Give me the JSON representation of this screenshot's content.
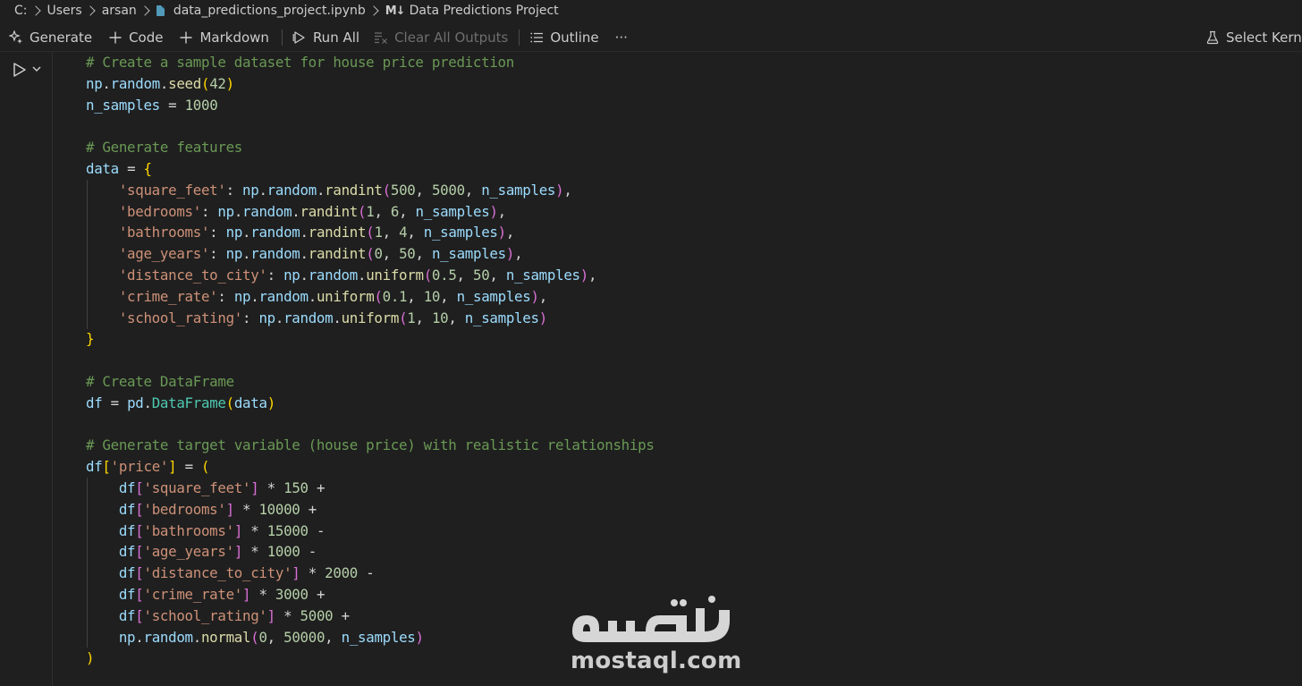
{
  "breadcrumb": {
    "drive": "C:",
    "folder1": "Users",
    "folder2": "arsan",
    "file": "data_predictions_project.ipynb",
    "section": "Data Predictions Project"
  },
  "toolbar": {
    "generate": "Generate",
    "code": "Code",
    "markdown": "Markdown",
    "run_all": "Run All",
    "clear_all_outputs": "Clear All Outputs",
    "outline": "Outline",
    "more": "···",
    "select_kernel": "Select Kernel"
  },
  "cell": {
    "code_lines": [
      "# Create a sample dataset for house price prediction",
      "np.random.seed(42)",
      "n_samples = 1000",
      "",
      "# Generate features",
      "data = {",
      "    'square_feet': np.random.randint(500, 5000, n_samples),",
      "    'bedrooms': np.random.randint(1, 6, n_samples),",
      "    'bathrooms': np.random.randint(1, 4, n_samples),",
      "    'age_years': np.random.randint(0, 50, n_samples),",
      "    'distance_to_city': np.random.uniform(0.5, 50, n_samples),",
      "    'crime_rate': np.random.uniform(0.1, 10, n_samples),",
      "    'school_rating': np.random.uniform(1, 10, n_samples)",
      "}",
      "",
      "# Create DataFrame",
      "df = pd.DataFrame(data)",
      "",
      "# Generate target variable (house price) with realistic relationships",
      "df['price'] = (",
      "    df['square_feet'] * 150 +",
      "    df['bedrooms'] * 10000 +",
      "    df['bathrooms'] * 15000 -",
      "    df['age_years'] * 1000 -",
      "    df['distance_to_city'] * 2000 -",
      "    df['crime_rate'] * 3000 +",
      "    df['school_rating'] * 5000 +",
      "    np.random.normal(0, 50000, n_samples)",
      ")"
    ]
  },
  "watermark": {
    "arabic": "مستقل",
    "latin": "mostaql.com"
  },
  "colors": {
    "background": "#1f1f1f",
    "comment": "#6a9955",
    "variable": "#9cdcfe",
    "function": "#dcdcaa",
    "number": "#b5cea8",
    "string": "#ce9178",
    "bracket_1": "#ffd700",
    "bracket_2": "#da70d6",
    "bracket_3": "#179fff"
  },
  "icons": [
    "sparkle-icon",
    "plus-icon",
    "run-all-icon",
    "clear-outputs-icon",
    "list-icon",
    "kernel-icon",
    "file-icon",
    "markdown-icon",
    "run-cell-icon",
    "chevron-down-icon"
  ]
}
